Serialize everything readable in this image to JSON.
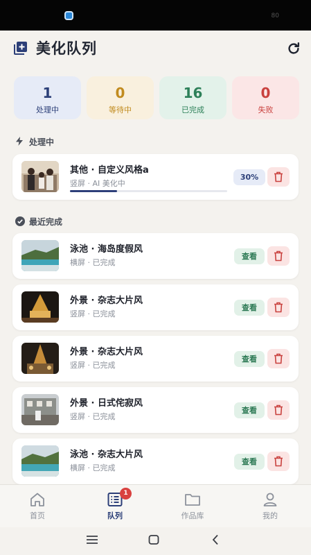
{
  "status_bar": {
    "battery": "80"
  },
  "header": {
    "title": "美化队列"
  },
  "stats": [
    {
      "value": "1",
      "label": "处理中"
    },
    {
      "value": "0",
      "label": "等待中"
    },
    {
      "value": "16",
      "label": "已完成"
    },
    {
      "value": "0",
      "label": "失败"
    }
  ],
  "processing_section": {
    "title": "处理中",
    "item": {
      "title": "其他 · 自定义风格a",
      "subtitle": "竖屏 · AI 美化中",
      "progress_label": "30%",
      "progress": 0.3
    }
  },
  "recent_section": {
    "title": "最近完成",
    "view_label": "查看",
    "items": [
      {
        "title": "泳池 · 海岛度假风",
        "subtitle": "横屏 · 已完成"
      },
      {
        "title": "外景 · 杂志大片风",
        "subtitle": "竖屏 · 已完成"
      },
      {
        "title": "外景 · 杂志大片风",
        "subtitle": "竖屏 · 已完成"
      },
      {
        "title": "外景 · 日式侘寂风",
        "subtitle": "竖屏 · 已完成"
      },
      {
        "title": "泳池 · 杂志大片风",
        "subtitle": "横屏 · 已完成"
      }
    ]
  },
  "tabbar": {
    "tabs": [
      {
        "label": "首页",
        "icon": "home-icon"
      },
      {
        "label": "队列",
        "icon": "list-icon",
        "badge": "1"
      },
      {
        "label": "作品库",
        "icon": "folder-icon"
      },
      {
        "label": "我的",
        "icon": "user-icon"
      }
    ]
  },
  "colors": {
    "accent": "#2c3f78",
    "processing_bg": "#e6ebf7",
    "waiting": "#c18b1f",
    "done": "#2d8059",
    "failed": "#c9413e"
  }
}
